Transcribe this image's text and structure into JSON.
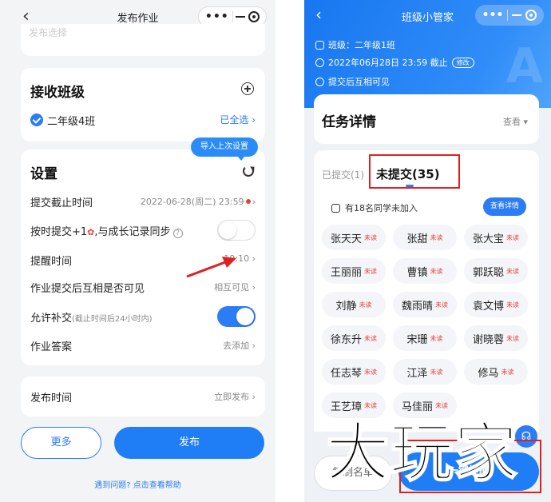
{
  "left": {
    "nav": {
      "title": "发布作业"
    },
    "top_card_faded": "发布选择",
    "class_card": {
      "title": "接收班级",
      "class_name": "二年级4班",
      "select_all": "已全选 ›"
    },
    "tooltip": "导入上次设置",
    "settings": {
      "title": "设置",
      "rows": [
        {
          "label": "提交截止时间",
          "value": "2022-06-28(周二) 23:59"
        },
        {
          "label_a": "按时提交+1",
          "label_b": ",与成长记录同步"
        },
        {
          "label": "提醒时间",
          "value": "19:10 ›"
        },
        {
          "label": "作业提交后互相是否可见",
          "value": "相互可见 ›"
        },
        {
          "label": "允许补交",
          "label_small": "(截止时间后24小时内)"
        },
        {
          "label": "作业答案",
          "value": "去添加 ›"
        }
      ],
      "toggle_ontime": false,
      "toggle_makeup": true
    },
    "publish_card": {
      "label": "发布时间",
      "value": "立即发布 ›"
    },
    "btn_more": "更多",
    "btn_publish": "发布",
    "help_link": "遇到问题? 点击查看帮助"
  },
  "right": {
    "nav": {
      "title": "班级小管家"
    },
    "info": {
      "class_line": "班级：二年级1班",
      "deadline_line": "2022年06月28日 23:59 截止",
      "edit_label": "修改",
      "visibility_line": "提交后互相可见"
    },
    "task_card": {
      "title": "任务详情",
      "view": "查看 ▾"
    },
    "tabs": {
      "submitted": "已提交(1)",
      "unsubmitted": "未提交(35)"
    },
    "notice": "有18名同学未加入",
    "detail_button": "查看详情",
    "unread_tag": "未读",
    "students": [
      "张天天",
      "张甜",
      "张大宝",
      "王丽丽",
      "曹镇",
      "郭跃聪",
      "刘静",
      "魏雨晴",
      "袁文博",
      "徐东升",
      "宋珊",
      "谢晓蓉",
      "任志琴",
      "江泽",
      "修马",
      "王艺璋",
      "马佳丽"
    ],
    "btn_copy": "复制名单",
    "btn_remind": "一键提醒",
    "fab_icon": "support-icon"
  },
  "watermark_text": "大玩家",
  "colors": {
    "primary": "#1f7ef5",
    "alert": "#e02020",
    "unread": "#e8403a"
  }
}
